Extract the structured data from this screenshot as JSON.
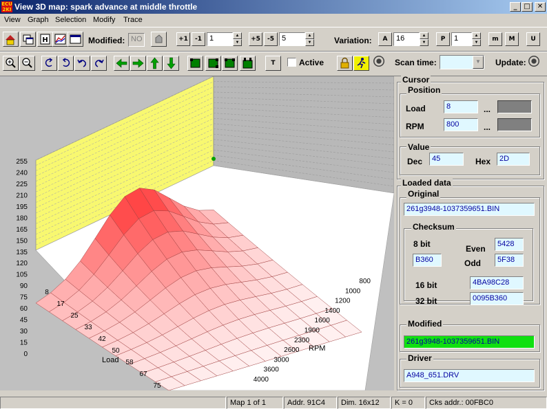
{
  "window": {
    "icon_text": "ECU\n2KI",
    "title": "View 3D map: spark advance at middle throttle",
    "controls": {
      "minimize": "_",
      "maximize": "□",
      "close": "✕"
    }
  },
  "menu": [
    "View",
    "Graph",
    "Selection",
    "Modify",
    "Trace"
  ],
  "toolbar1": {
    "modified_label": "Modified:",
    "modified_value": "NO",
    "step1_value": "1",
    "step5_value": "5",
    "variation_label": "Variation:",
    "variation_a": "16",
    "variation_p": "1",
    "btn_plus1": "+1",
    "btn_minus1": "-1",
    "btn_plus5": "+5",
    "btn_minus5": "-5",
    "btn_a": "A",
    "btn_p": "P",
    "btn_m_lower": "m",
    "btn_m_upper": "M",
    "btn_u": "U"
  },
  "toolbar2": {
    "active_label": "Active",
    "scan_time_label": "Scan time:",
    "scan_time_value": "",
    "update_label": "Update:",
    "btn_t": "T"
  },
  "graph": {
    "z_ticks": [
      "255",
      "240",
      "225",
      "210",
      "195",
      "180",
      "165",
      "150",
      "135",
      "120",
      "105",
      "90",
      "75",
      "60",
      "45",
      "30",
      "15",
      "0"
    ],
    "load_ticks": [
      "8",
      "17",
      "25",
      "33",
      "42",
      "50",
      "58",
      "67",
      "75"
    ],
    "load_label": "Load",
    "rpm_ticks": [
      "800",
      "1000",
      "1200",
      "1400",
      "1600",
      "1900",
      "2300",
      "2600",
      "3000",
      "3600",
      "4000"
    ],
    "rpm_label": "RPM"
  },
  "cursor": {
    "title": "Cursor",
    "position_title": "Position",
    "load_label": "Load",
    "load_value": "8",
    "rpm_label": "RPM",
    "rpm_value": "800",
    "ellipsis": "...",
    "value_title": "Value",
    "dec_label": "Dec",
    "dec_value": "45",
    "hex_label": "Hex",
    "hex_value": "2D"
  },
  "loaded": {
    "title": "Loaded data",
    "original_title": "Original",
    "original_file": "261g3948-1037359651.BIN",
    "checksum_title": "Checksum",
    "bit8_label": "8 bit",
    "bit8_value": "B360",
    "even_label": "Even",
    "even_value": "5428",
    "odd_label": "Odd",
    "odd_value": "5F38",
    "bit16_label": "16 bit",
    "bit16_value": "4BA98C28",
    "bit32_label": "32 bit",
    "bit32_value": "0095B360",
    "modified_title": "Modified",
    "modified_file": "261g3948-1037359651.BIN",
    "modified_color": "#10e010",
    "driver_title": "Driver",
    "driver_file": "A948_651.DRV"
  },
  "status": {
    "map": "Map 1 of 1",
    "addr": "Addr. 91C4",
    "dim": "Dim. 16x12",
    "k": "K = 0",
    "cks": "Cks addr.: 00FBC0"
  }
}
